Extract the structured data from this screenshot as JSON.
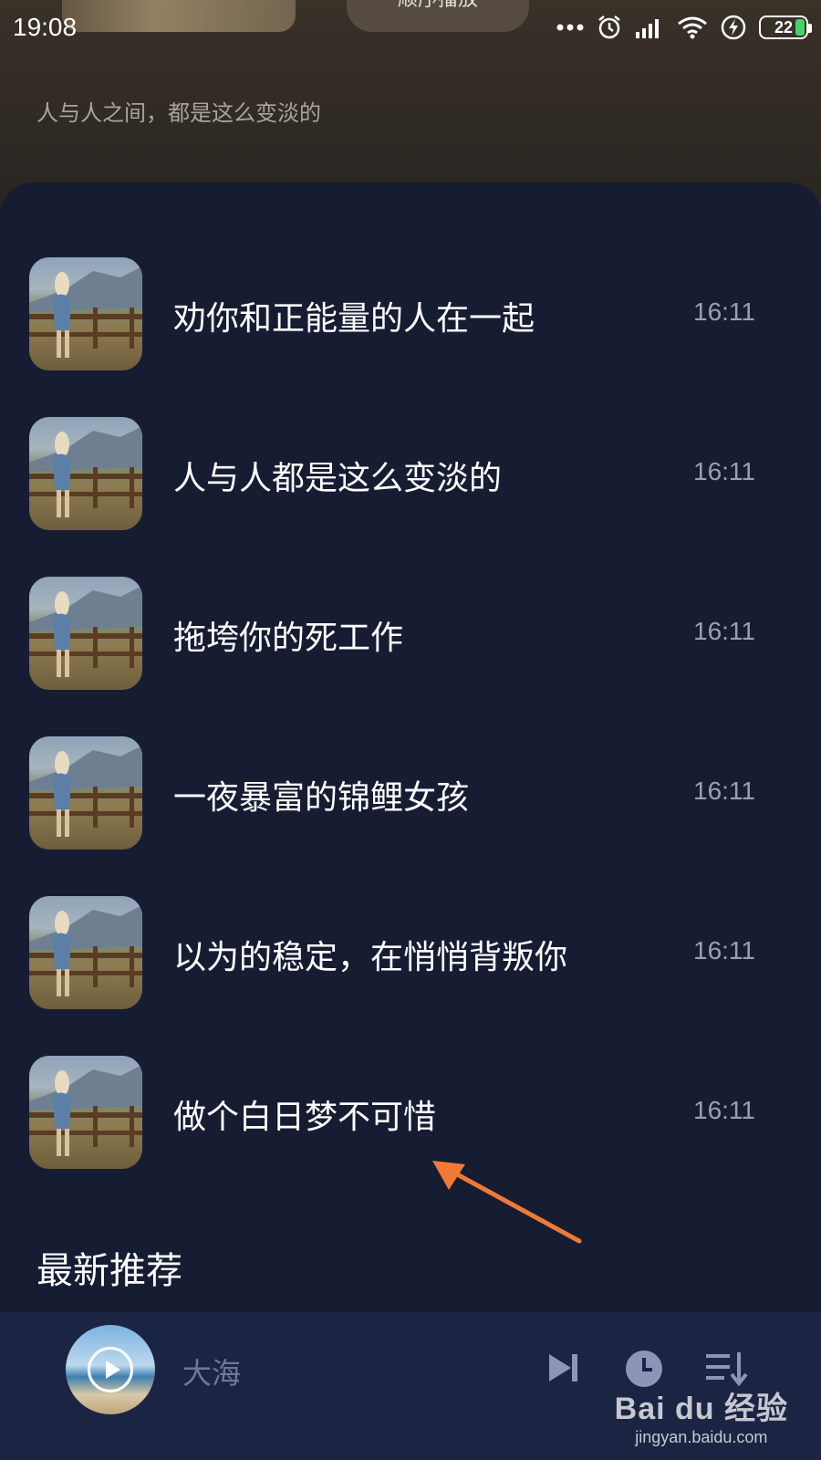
{
  "status_bar": {
    "time": "19:08",
    "battery": "22",
    "icons": [
      "more-dots-icon",
      "alarm-icon",
      "signal-icon",
      "wifi-icon",
      "charging-icon",
      "battery-icon"
    ]
  },
  "header": {
    "play_order_label": "顺序播放",
    "subtitle": "人与人之间，都是这么变淡的"
  },
  "songs": [
    {
      "title": "劝你和正能量的人在一起",
      "time": "16:11"
    },
    {
      "title": "人与人都是这么变淡的",
      "time": "16:11"
    },
    {
      "title": "拖垮你的死工作",
      "time": "16:11"
    },
    {
      "title": "一夜暴富的锦鲤女孩",
      "time": "16:11"
    },
    {
      "title": "以为的稳定，在悄悄背叛你",
      "time": "16:11"
    },
    {
      "title": "做个白日梦不可惜",
      "time": "16:11"
    }
  ],
  "section_title": "最新推荐",
  "mini_player": {
    "title": "大海",
    "icons": [
      "play-icon",
      "next-icon",
      "timer-icon",
      "playlist-icon"
    ]
  },
  "watermark": {
    "main": "Bai du 经验",
    "sub": "jingyan.baidu.com"
  },
  "colors": {
    "background": "#161d33",
    "header_bg": "#2f2a24",
    "player_bg": "#1c2444",
    "annotation_arrow": "#f07a35",
    "time_text": "#9aa0b0"
  }
}
